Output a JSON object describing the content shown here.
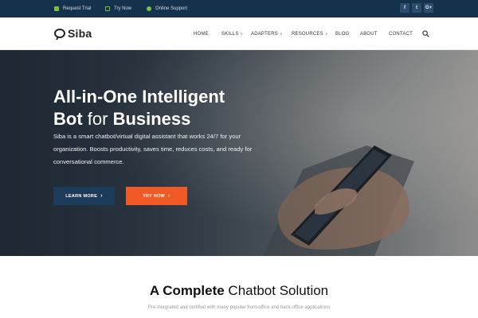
{
  "topbar": {
    "links": [
      {
        "label": "Request Trial",
        "icon": "trial-icon"
      },
      {
        "label": "Try Now",
        "icon": "edit-icon"
      },
      {
        "label": "Online Support",
        "icon": "support-icon"
      }
    ],
    "social": [
      {
        "glyph": "f",
        "icon": "facebook-icon"
      },
      {
        "glyph": "t",
        "icon": "twitter-icon"
      },
      {
        "glyph": "G+",
        "icon": "google-plus-icon"
      }
    ]
  },
  "navbar": {
    "logo": "Siba",
    "items": [
      {
        "label": "HOME",
        "has_dropdown": false
      },
      {
        "label": "SKILLS",
        "has_dropdown": true
      },
      {
        "label": "ADAPTERS",
        "has_dropdown": true
      },
      {
        "label": "RESOURCES",
        "has_dropdown": true
      },
      {
        "label": "BLOG",
        "has_dropdown": false
      },
      {
        "label": "ABOUT",
        "has_dropdown": false
      },
      {
        "label": "CONTACT",
        "has_dropdown": false
      }
    ],
    "caret": "∨",
    "search_icon": "search-icon"
  },
  "hero": {
    "title_line1": "All-in-One Intelligent",
    "title_line2_bold_start": "Bot",
    "title_line2_light": " for ",
    "title_line2_bold_end": "Business",
    "description": "Siba is a smart chatbot/virtual digital assistant that works 24/7 for your organization. Boosts productivity, saves time, reduces costs, and ready for conversational commerce.",
    "learn_more_label": "LEARN MORE",
    "try_now_label": "TRY NOW",
    "chevron": "›"
  },
  "section": {
    "title_bold": "A Complete",
    "title_rest": " Chatbot Solution",
    "subtitle": "Pre-integrated and certified with many popular front-office and back-office applications"
  },
  "colors": {
    "topbar_bg": "#15324d",
    "accent_green": "#7ac142",
    "learn_more_bg": "#1d3c5c",
    "try_now_bg": "#f15a24"
  }
}
